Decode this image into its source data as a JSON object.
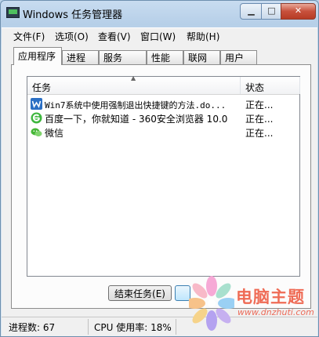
{
  "window": {
    "title": "Windows 任务管理器"
  },
  "menu": [
    {
      "label": "文件(F)"
    },
    {
      "label": "选项(O)"
    },
    {
      "label": "查看(V)"
    },
    {
      "label": "窗口(W)"
    },
    {
      "label": "帮助(H)"
    }
  ],
  "tabs": [
    {
      "label": "应用程序",
      "active": true
    },
    {
      "label": "进程"
    },
    {
      "label": "服务"
    },
    {
      "label": "性能"
    },
    {
      "label": "联网"
    },
    {
      "label": "用户"
    }
  ],
  "table": {
    "columns": [
      "任务",
      "状态"
    ],
    "rows": [
      {
        "task": "Win7系统中使用强制退出快捷键的方法.do...",
        "status": "正在...",
        "icon": "word-document-icon"
      },
      {
        "task": "百度一下，你就知道 - 360安全浏览器 10.0",
        "status": "正在...",
        "icon": "360-browser-icon"
      },
      {
        "task": "微信",
        "status": "正在...",
        "icon": "wechat-icon"
      }
    ]
  },
  "buttons": {
    "end_task": "结束任务(E)"
  },
  "status": {
    "processes": "进程数: 67",
    "cpu": "CPU 使用率: 18%"
  },
  "watermark": {
    "brand": "电脑主题",
    "url": "www.dnzhuti.com"
  },
  "colors": {
    "close_button": "#c7503b",
    "watermark_text": "#ef6b55"
  }
}
